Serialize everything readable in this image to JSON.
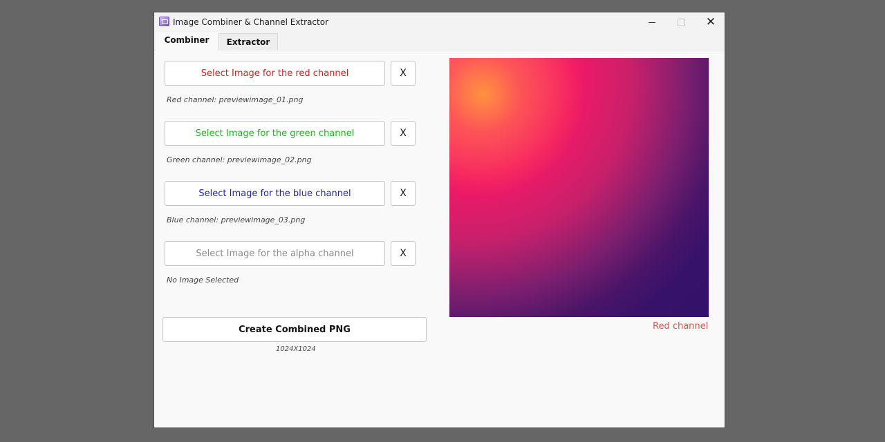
{
  "window": {
    "title": "Image Combiner & Channel Extractor",
    "controls": {
      "minimize": "—",
      "maximize": "□",
      "close": "✕"
    }
  },
  "tabs": [
    "Combiner",
    "Extractor"
  ],
  "channels": [
    {
      "button_label": "Select Image for the red channel",
      "color": "#d21f1f",
      "remove_label": "X",
      "status": "Red channel: previewimage_01.png"
    },
    {
      "button_label": "Select Image for the green channel",
      "color": "#1fb41f",
      "remove_label": "X",
      "status": "Green channel: previewimage_02.png"
    },
    {
      "button_label": "Select Image for the blue channel",
      "color": "#1f23b4",
      "remove_label": "X",
      "status": "Blue channel: previewimage_03.png"
    },
    {
      "button_label": "Select Image for the alpha channel",
      "color": "#8a8a8a",
      "remove_label": "X",
      "status": "No Image Selected"
    }
  ],
  "create_button_label": "Create Combined PNG",
  "resolution": "1024X1024",
  "preview": {
    "caption": "Red channel",
    "caption_color": "#d9534f"
  },
  "icons": {
    "app": "image-combiner-app-icon",
    "minimize": "minimize-icon",
    "maximize": "maximize-icon",
    "close": "close-icon"
  }
}
